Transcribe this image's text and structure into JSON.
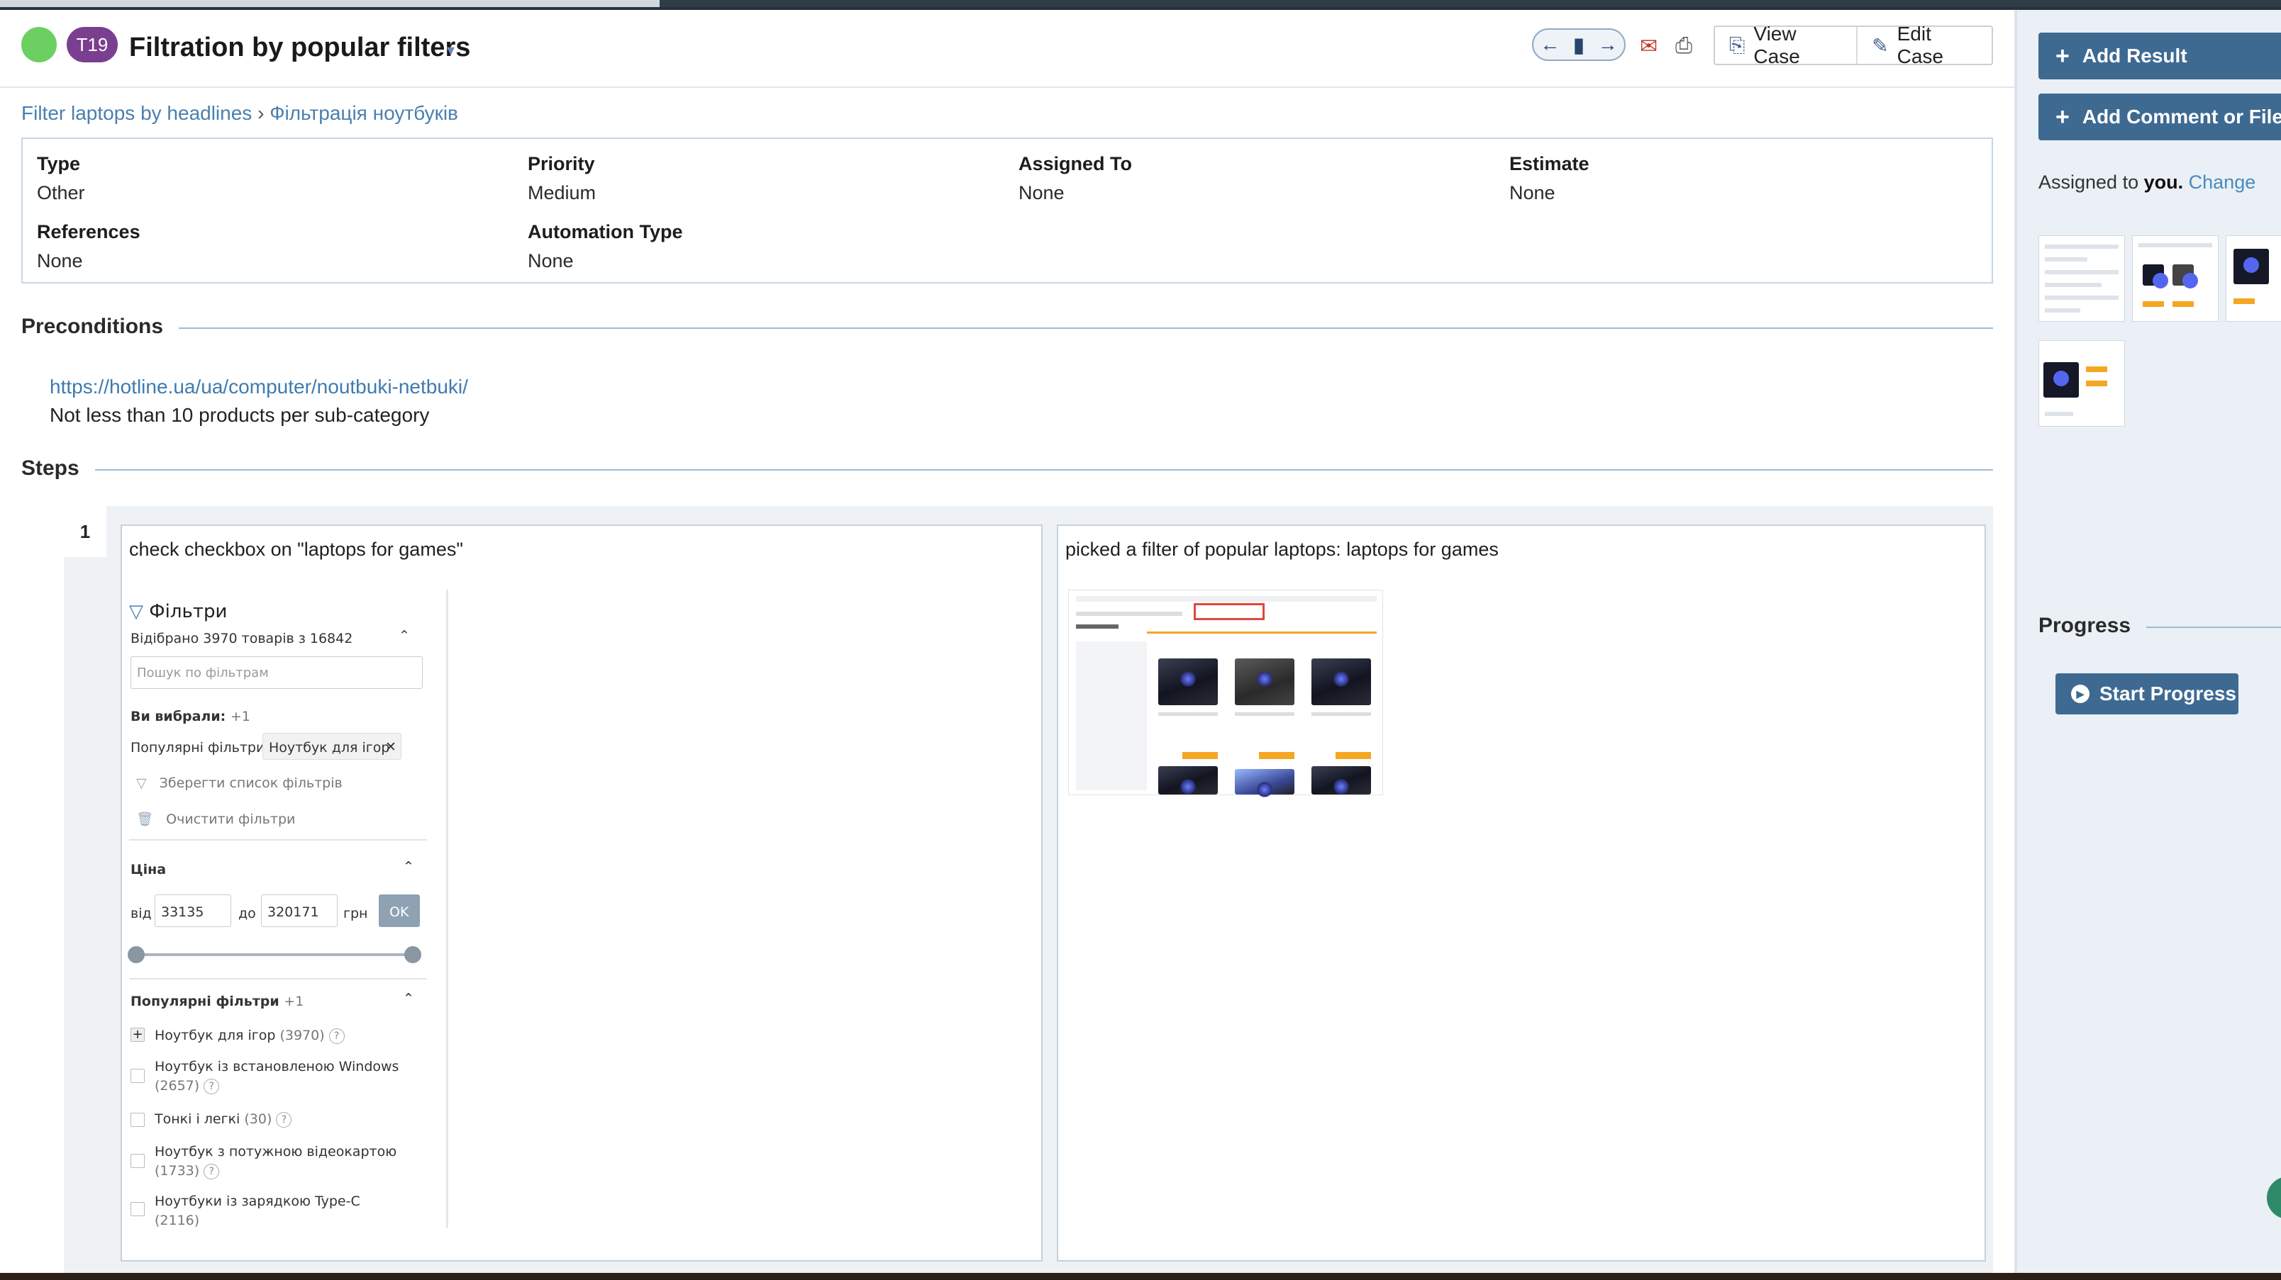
{
  "header": {
    "case_id": "T19",
    "title": "Filtration by popular filters",
    "view_case": "View Case",
    "edit_case": "Edit Case"
  },
  "breadcrumb": {
    "parent": "Filter laptops by headlines",
    "separator": "›",
    "current": "Фільтрація ноутбуків"
  },
  "fields": [
    {
      "label": "Type",
      "value": "Other"
    },
    {
      "label": "Priority",
      "value": "Medium"
    },
    {
      "label": "Assigned To",
      "value": "None"
    },
    {
      "label": "Estimate",
      "value": "None"
    },
    {
      "label": "References",
      "value": "None"
    },
    {
      "label": "Automation Type",
      "value": "None"
    }
  ],
  "preconditions": {
    "title": "Preconditions",
    "link": "https://hotline.ua/ua/computer/noutbuki-netbuki/",
    "text": "Not less than 10 products per sub-category"
  },
  "steps": {
    "title": "Steps",
    "items": [
      {
        "number": "1",
        "content": "check checkbox on \"laptops for games\"",
        "expected": "picked a filter of popular laptops: laptops for games"
      }
    ]
  },
  "filter_panel": {
    "title": "Фільтри",
    "selected_count": "Відібрано 3970 товарів з 16842",
    "search_placeholder": "Пошук по фільтрам",
    "you_chose": "Ви вибрали:",
    "you_chose_count": "+1",
    "popular_label": "Популярні фільтри:",
    "chip": "Ноутбук для ігор",
    "save_list": "Зберегти список фільтрів",
    "clear": "Очистити фільтри",
    "price_title": "Ціна",
    "from_label": "від",
    "from_value": "33135",
    "to_label": "до",
    "to_value": "320171",
    "currency": "грн",
    "ok": "OK",
    "popular_title": "Популярні фільтри",
    "popular_count": "+1",
    "options": [
      {
        "label": "Ноутбук для ігор",
        "count": "(3970)",
        "checked": true
      },
      {
        "label": "Ноутбук із встановленою Windows",
        "count": "(2657)",
        "checked": false
      },
      {
        "label": "Тонкі і легкі",
        "count": "(30)",
        "checked": false
      },
      {
        "label": "Ноутбук з потужною відеокартою",
        "count": "(1733)",
        "checked": false
      },
      {
        "label": "Ноутбуки із зарядкою Type-C",
        "count": "(2116)",
        "checked": false
      }
    ]
  },
  "sidebar": {
    "add_result": "Add Result",
    "add_comment": "Add Comment or File",
    "assigned_prefix": "Assigned to",
    "assigned_user": "you.",
    "change": "Change",
    "progress_title": "Progress",
    "start_progress": "Start Progress"
  },
  "colors": {
    "status": "#6ccf62",
    "case_badge": "#7a3f8f",
    "primary_button": "#3e6a92",
    "link": "#4a7fb0"
  }
}
